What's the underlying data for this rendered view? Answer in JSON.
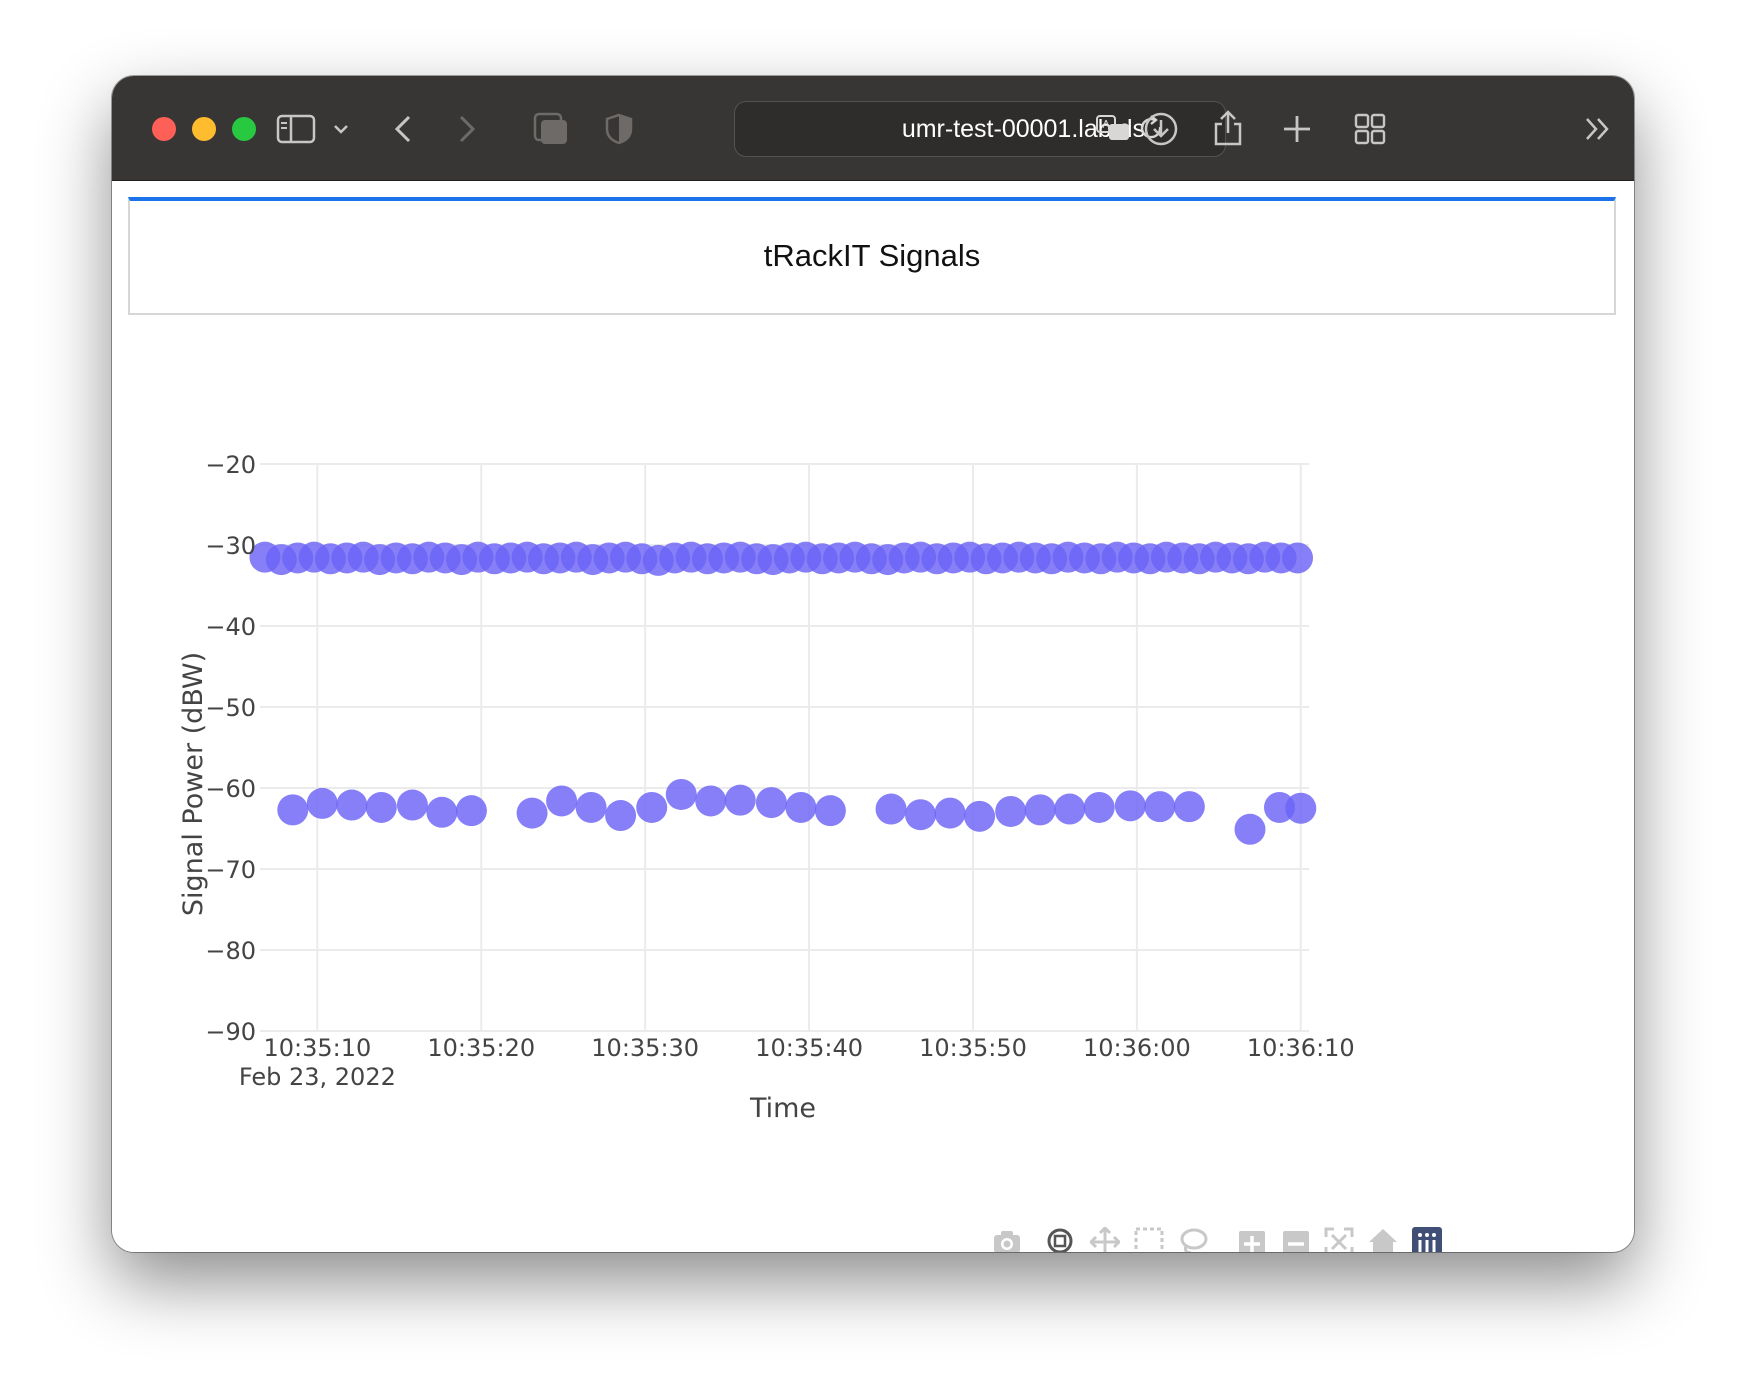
{
  "browser": {
    "url": "umr-test-00001.lab.ds"
  },
  "page": {
    "title": "tRackIT Signals"
  },
  "chart_data": {
    "type": "scatter",
    "title": "",
    "xlabel": "Time",
    "ylabel": "Signal Power (dBW)",
    "ylim": [
      -90,
      -20
    ],
    "yticks": [
      -20,
      -30,
      -40,
      -50,
      -60,
      -70,
      -80,
      -90
    ],
    "ytick_labels": [
      "−20",
      "−30",
      "−40",
      "−50",
      "−60",
      "−70",
      "−80",
      "−90"
    ],
    "x_date": "Feb 23, 2022",
    "xlim": [
      "10:35:06.5",
      "10:36:10.5"
    ],
    "xticks": [
      "10:35:10",
      "10:35:20",
      "10:35:30",
      "10:35:40",
      "10:35:50",
      "10:36:00",
      "10:36:10"
    ],
    "xtick_labels": [
      "10:35:10",
      "10:35:20",
      "10:35:30",
      "10:35:40",
      "10:35:50",
      "10:36:00",
      "10:36:10"
    ],
    "xtick_sublabel": "Feb 23, 2022",
    "grid": true,
    "marker_color": "#6b63f5",
    "series": [
      {
        "x": [
          "10:35:06.8",
          "10:35:07.8",
          "10:35:08.8",
          "10:35:09.8",
          "10:35:10.8",
          "10:35:11.8",
          "10:35:12.8",
          "10:35:13.8",
          "10:35:14.8",
          "10:35:15.8",
          "10:35:16.8",
          "10:35:17.8",
          "10:35:18.8",
          "10:35:19.8",
          "10:35:20.8",
          "10:35:21.8",
          "10:35:22.8",
          "10:35:23.8",
          "10:35:24.8",
          "10:35:25.8",
          "10:35:26.8",
          "10:35:27.8",
          "10:35:28.8",
          "10:35:29.8",
          "10:35:30.8",
          "10:35:31.8",
          "10:35:32.8",
          "10:35:33.8",
          "10:35:34.8",
          "10:35:35.8",
          "10:35:36.8",
          "10:35:37.8",
          "10:35:38.8",
          "10:35:39.8",
          "10:35:40.8",
          "10:35:41.8",
          "10:35:42.8",
          "10:35:43.8",
          "10:35:44.8",
          "10:35:45.8",
          "10:35:46.8",
          "10:35:47.8",
          "10:35:48.8",
          "10:35:49.8",
          "10:35:50.8",
          "10:35:51.8",
          "10:35:52.8",
          "10:35:53.8",
          "10:35:54.8",
          "10:35:55.8",
          "10:35:56.8",
          "10:35:57.8",
          "10:35:58.8",
          "10:35:59.8",
          "10:36:00.8",
          "10:36:01.8",
          "10:36:02.8",
          "10:36:03.8",
          "10:36:04.8",
          "10:36:05.8",
          "10:36:06.8",
          "10:36:07.8",
          "10:36:08.8",
          "10:36:09.8"
        ],
        "y": [
          -31.5,
          -31.8,
          -31.6,
          -31.5,
          -31.7,
          -31.6,
          -31.5,
          -31.8,
          -31.6,
          -31.7,
          -31.5,
          -31.6,
          -31.8,
          -31.5,
          -31.7,
          -31.6,
          -31.5,
          -31.7,
          -31.6,
          -31.5,
          -31.8,
          -31.6,
          -31.5,
          -31.7,
          -31.9,
          -31.6,
          -31.5,
          -31.7,
          -31.6,
          -31.5,
          -31.7,
          -31.8,
          -31.6,
          -31.5,
          -31.7,
          -31.6,
          -31.5,
          -31.7,
          -31.8,
          -31.6,
          -31.5,
          -31.7,
          -31.6,
          -31.5,
          -31.7,
          -31.6,
          -31.5,
          -31.6,
          -31.7,
          -31.5,
          -31.6,
          -31.7,
          -31.5,
          -31.6,
          -31.7,
          -31.5,
          -31.6,
          -31.7,
          -31.5,
          -31.6,
          -31.7,
          -31.5,
          -31.6,
          -31.6
        ]
      },
      {
        "x": [
          "10:35:08.5",
          "10:35:10.3",
          "10:35:12.1",
          "10:35:13.9",
          "10:35:15.8",
          "10:35:17.6",
          "10:35:19.4",
          "10:35:23.1",
          "10:35:24.9",
          "10:35:26.7",
          "10:35:28.5",
          "10:35:30.4",
          "10:35:32.2",
          "10:35:34.0",
          "10:35:35.8",
          "10:35:37.7",
          "10:35:39.5",
          "10:35:41.3",
          "10:35:45.0",
          "10:35:46.8",
          "10:35:48.6",
          "10:35:50.4",
          "10:35:52.3",
          "10:35:54.1",
          "10:35:55.9",
          "10:35:57.7",
          "10:35:59.6",
          "10:36:01.4",
          "10:36:03.2",
          "10:36:06.9",
          "10:36:08.7",
          "10:36:10.0"
        ],
        "y": [
          -62.7,
          -61.9,
          -62.1,
          -62.4,
          -62.1,
          -63.0,
          -62.8,
          -63.1,
          -61.6,
          -62.4,
          -63.4,
          -62.4,
          -60.8,
          -61.6,
          -61.5,
          -61.8,
          -62.4,
          -62.8,
          -62.6,
          -63.3,
          -63.1,
          -63.5,
          -62.9,
          -62.7,
          -62.6,
          -62.4,
          -62.2,
          -62.3,
          -62.3,
          -65.1,
          -62.4,
          -62.5
        ]
      }
    ]
  }
}
